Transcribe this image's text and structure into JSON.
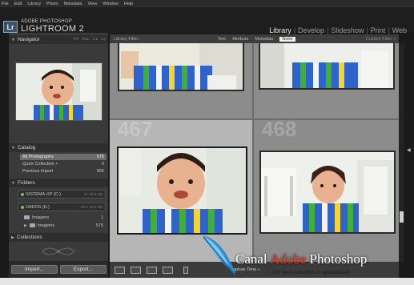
{
  "menubar": {
    "items": [
      "File",
      "Edit",
      "Library",
      "Photo",
      "Metadata",
      "View",
      "Window",
      "Help"
    ]
  },
  "header": {
    "logo": "Lr",
    "brand_top": "ADOBE PHOTOSHOP",
    "brand_main": "LIGHTROOM 2",
    "modules": [
      "Library",
      "Develop",
      "Slideshow",
      "Print",
      "Web"
    ],
    "active_module": "Library"
  },
  "navigator": {
    "title": "Navigator",
    "zoom_options": [
      "FIT",
      "FILL",
      "1:1",
      "1:2"
    ]
  },
  "catalog": {
    "title": "Catalog",
    "items": [
      {
        "label": "All Photographs",
        "count": "575"
      },
      {
        "label": "Quick Collection +",
        "count": "0"
      },
      {
        "label": "Previous Import",
        "count": "555"
      }
    ]
  },
  "folders": {
    "title": "Folders",
    "volumes": [
      {
        "label": "SISTEMA-XP (C:)",
        "info": "8 / 29.3 GB"
      },
      {
        "label": "DADOS (E:)",
        "info": "104 / 40.0 GB"
      }
    ],
    "subfolders": [
      {
        "label": "Imagens",
        "count": "1"
      },
      {
        "label": "Imagens",
        "count": "575"
      }
    ]
  },
  "collections": {
    "title": "Collections"
  },
  "buttons": {
    "import": "Import...",
    "export": "Export..."
  },
  "filter_bar": {
    "title": "Library Filter :",
    "options": [
      "Text",
      "Attribute",
      "Metadata",
      "None"
    ],
    "selected": "None",
    "preset": "Custom Filter ÷"
  },
  "grid": {
    "cells": [
      {
        "number": "467"
      },
      {
        "number": "468"
      }
    ]
  },
  "toolbar": {
    "sort_label": "Capture Time ÷"
  },
  "watermark": {
    "canal": "Canal",
    "adobe": "Adobe",
    "photoshop": "Photoshop",
    "tagline": "Um novo conceito em aprendizado"
  },
  "colors": {
    "panel": "#3a3a3a",
    "grid_bg": "#6b6b6b",
    "selected_cell": "#b6b6b6",
    "shirt_blue": "#2f63c8",
    "shirt_green": "#3fae3a",
    "watermark_red": "#ef3b2a"
  }
}
